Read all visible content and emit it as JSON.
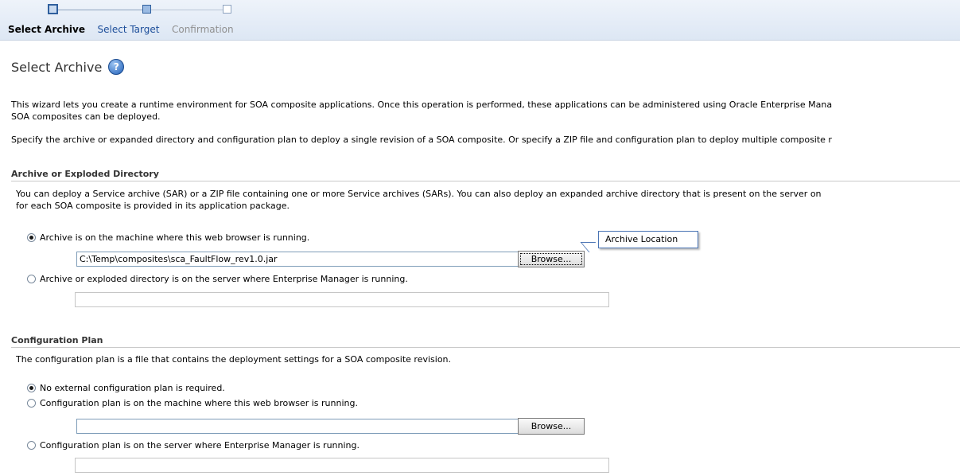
{
  "train": {
    "steps": [
      {
        "label": "Select Archive",
        "state": "current"
      },
      {
        "label": "Select Target",
        "state": "next"
      },
      {
        "label": "Confirmation",
        "state": "disabled"
      }
    ]
  },
  "page": {
    "title": "Select Archive",
    "help_icon": "help-icon",
    "intro_line1": "This wizard lets you create a runtime environment for SOA composite applications. Once this operation is performed, these applications can be administered using Oracle Enterprise Mana",
    "intro_line2": "SOA composites can be deployed.",
    "intro2": "Specify the archive or expanded directory and configuration plan to deploy a single revision of a SOA composite. Or specify a ZIP file and configuration plan to deploy multiple composite r"
  },
  "archive": {
    "heading": "Archive or Exploded Directory",
    "desc_line1": "You can deploy a Service archive (SAR) or a ZIP file containing one or more Service archives (SARs). You can also deploy an expanded archive directory that is present on the server on",
    "desc_line2": "for each SOA composite is provided in its application package.",
    "option_local": "Archive is on the machine where this web browser is running.",
    "local_value": "C:\\Temp\\composites\\sca_FaultFlow_rev1.0.jar",
    "browse_label": "Browse...",
    "option_server": "Archive or exploded directory is on the server where Enterprise Manager is running.",
    "server_value": "",
    "callout": "Archive Location"
  },
  "plan": {
    "heading": "Configuration Plan",
    "desc": "The configuration plan is a file that contains the deployment settings for a SOA composite revision.",
    "option_none": "No external configuration plan is required.",
    "option_local": "Configuration plan is on the machine where this web browser is running.",
    "local_value": "",
    "browse_label": "Browse...",
    "option_server": "Configuration plan is on the server where Enterprise Manager is running.",
    "server_value": ""
  }
}
